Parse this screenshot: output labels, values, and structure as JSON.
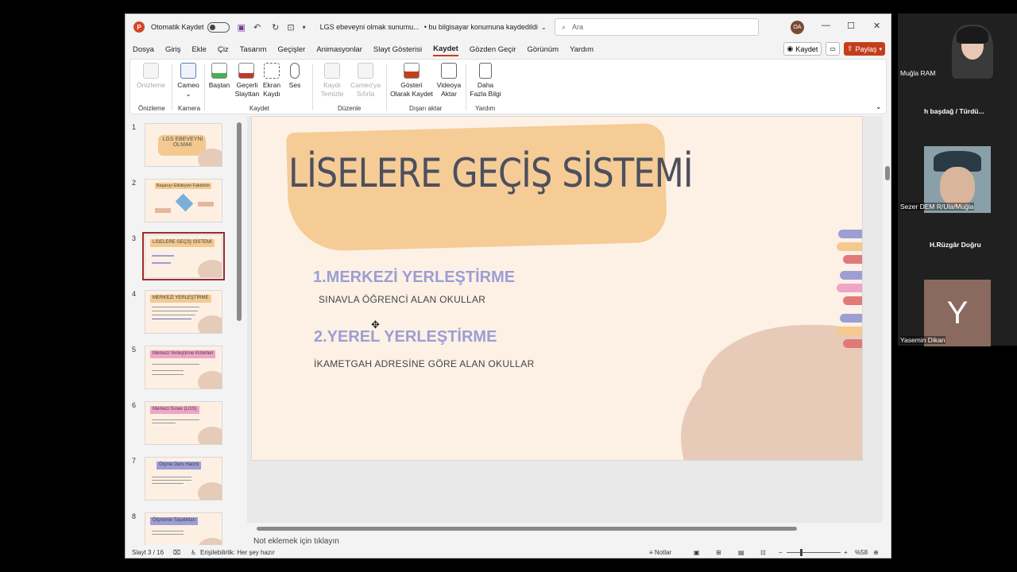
{
  "titlebar": {
    "app_icon": "P",
    "autosave_label": "Otomatik Kaydet",
    "doc_title": "LGS ebeveyni olmak sunumu...",
    "save_location": "• bu bilgisayar konumuna kaydedildi",
    "search_placeholder": "Ara",
    "avatar_initials": "OA"
  },
  "menu": {
    "items": [
      "Dosya",
      "Giriş",
      "Ekle",
      "Çiz",
      "Tasarım",
      "Geçişler",
      "Animasyonlar",
      "Slayt Gösterisi",
      "Kaydet",
      "Gözden Geçir",
      "Görünüm",
      "Yardım"
    ],
    "active": "Kaydet",
    "record_button": "Kaydet",
    "share_button": "Paylaş"
  },
  "ribbon": {
    "buttons": [
      {
        "label": "Önizleme",
        "disabled": true
      },
      {
        "label": "Cameo",
        "disabled": false
      },
      {
        "label": "Baştan",
        "disabled": false
      },
      {
        "label": "Geçerli Slayttan",
        "disabled": false
      },
      {
        "label": "Ekran Kaydı",
        "disabled": false
      },
      {
        "label": "Ses",
        "disabled": false
      },
      {
        "label": "Kaydı Temizle",
        "disabled": true
      },
      {
        "label": "Cameo'ya Sıfırla",
        "disabled": true
      },
      {
        "label": "Gösteri Olarak Kaydet",
        "disabled": false
      },
      {
        "label": "Videoya Aktar",
        "disabled": false
      },
      {
        "label": "Daha Fazla Bilgi",
        "disabled": false
      }
    ],
    "groups": [
      "Önizleme",
      "Kamera",
      "Kaydet",
      "Düzenle",
      "Dışarı aktar",
      "Yardım"
    ]
  },
  "thumbnails": [
    {
      "num": "1",
      "title": "LGS EBEVEYNİ OLMAK"
    },
    {
      "num": "2",
      "title": "Başarıyı Etkileyen Faktörler"
    },
    {
      "num": "3",
      "title": "LİSELERE GEÇİŞ SİSTEMİ"
    },
    {
      "num": "4",
      "title": "MERKEZİ YERLEŞTİRME"
    },
    {
      "num": "5",
      "title": "Merkezi Yerleştirme Kriterleri"
    },
    {
      "num": "6",
      "title": "Merkezi Sınav (LGS)"
    },
    {
      "num": "7",
      "title": "Ölçme Ders Hacmi"
    },
    {
      "num": "8",
      "title": "Ölçmenin Taşıdıkları"
    }
  ],
  "selected_slide": "3",
  "slide": {
    "title": "LİSELERE GEÇİŞ SİSTEMİ",
    "heading1": "1.MERKEZİ YERLEŞTİRME",
    "sub1": "SINAVLA ÖĞRENCİ ALAN OKULLAR",
    "heading2": "2.YEREL YERLEŞTİRME",
    "sub2": "İKAMETGAH ADRESİNE GÖRE ALAN OKULLAR",
    "stripe_colors": [
      "#9c9ed4",
      "#f4c98f",
      "#e07a7a",
      "#9c9ed4",
      "#f0a4c8",
      "#e07a7a",
      "#9c9ed4",
      "#f4c98f",
      "#e07a7a"
    ]
  },
  "notes_placeholder": "Not eklemek için tıklayın",
  "statusbar": {
    "slide_info": "Slayt 3 / 16",
    "accessibility": "Erişilebilirlik: Her şey hazır",
    "notes_label": "Notlar",
    "zoom": "%58"
  },
  "participants": [
    {
      "name": "Muğla RAM",
      "has_video": true
    },
    {
      "name": "h başdağ / Türdü...",
      "has_video": false
    },
    {
      "name": "Sezer DEM R/Ula/Muğla",
      "has_video": true
    },
    {
      "name": "H.Rüzgâr Doğru",
      "has_video": false
    },
    {
      "name": "Yasemin Dikan",
      "avatar_letter": "Y",
      "has_video": false
    }
  ],
  "colors": {
    "accent": "#c43e1c",
    "slide_bg": "#fdf1e6",
    "heading_purple": "#9c9ed4",
    "band_orange": "#f4c98f",
    "selection_border": "#9e2a2b",
    "avatar_bg": "#8a6a5e"
  }
}
